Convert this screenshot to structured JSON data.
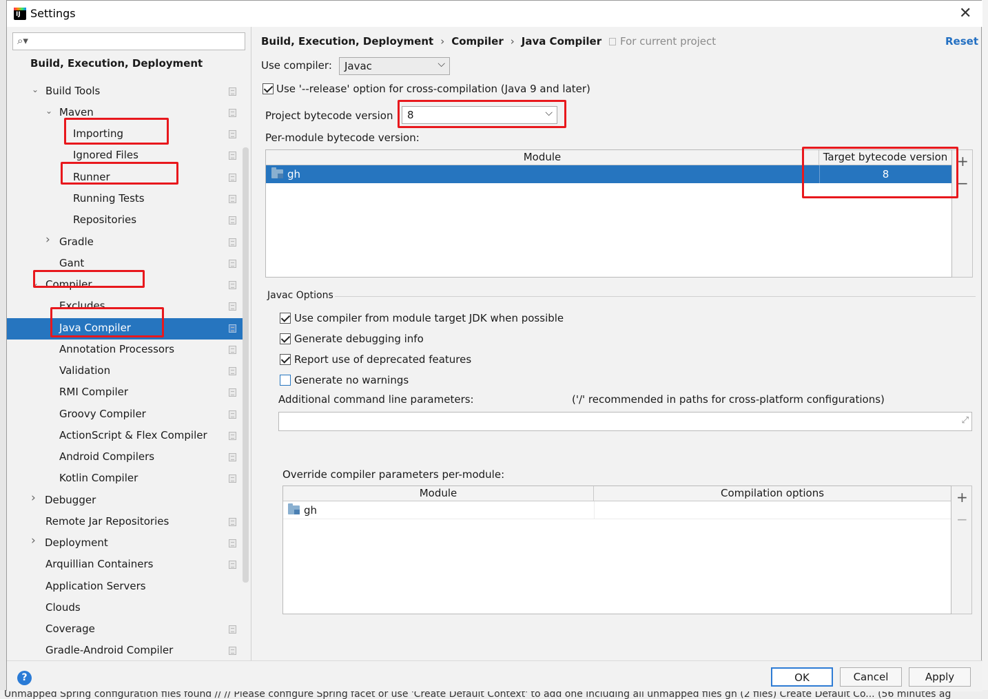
{
  "window": {
    "title": "Settings"
  },
  "background": {
    "status_text": "Unmapped Spring configuration files found  // // Please configure Spring facet or use 'Create Default Context' to add one including all unmapped files  gh (2 files)  Create Default Co...  (56 minutes ag"
  },
  "sidebar": {
    "search_placeholder": "",
    "section_title": "Build, Execution, Deployment",
    "items": [
      {
        "label": "Build Tools",
        "arrow": "expanded",
        "project_scoped": true
      },
      {
        "label": "Maven",
        "arrow": "expanded",
        "project_scoped": true
      },
      {
        "label": "Importing",
        "arrow": "",
        "project_scoped": true
      },
      {
        "label": "Ignored Files",
        "arrow": "",
        "project_scoped": true
      },
      {
        "label": "Runner",
        "arrow": "",
        "project_scoped": true
      },
      {
        "label": "Running Tests",
        "arrow": "",
        "project_scoped": true
      },
      {
        "label": "Repositories",
        "arrow": "",
        "project_scoped": true
      },
      {
        "label": "Gradle",
        "arrow": "collapsed",
        "project_scoped": true
      },
      {
        "label": "Gant",
        "arrow": "",
        "project_scoped": true
      },
      {
        "label": "Compiler",
        "arrow": "expanded",
        "project_scoped": true
      },
      {
        "label": "Excludes",
        "arrow": "",
        "project_scoped": true
      },
      {
        "label": "Java Compiler",
        "arrow": "",
        "project_scoped": true,
        "selected": true
      },
      {
        "label": "Annotation Processors",
        "arrow": "",
        "project_scoped": true
      },
      {
        "label": "Validation",
        "arrow": "",
        "project_scoped": true
      },
      {
        "label": "RMI Compiler",
        "arrow": "",
        "project_scoped": true
      },
      {
        "label": "Groovy Compiler",
        "arrow": "",
        "project_scoped": true
      },
      {
        "label": "ActionScript & Flex Compiler",
        "arrow": "",
        "project_scoped": true
      },
      {
        "label": "Android Compilers",
        "arrow": "",
        "project_scoped": true
      },
      {
        "label": "Kotlin Compiler",
        "arrow": "",
        "project_scoped": true
      },
      {
        "label": "Debugger",
        "arrow": "collapsed",
        "project_scoped": false
      },
      {
        "label": "Remote Jar Repositories",
        "arrow": "",
        "project_scoped": true
      },
      {
        "label": "Deployment",
        "arrow": "collapsed",
        "project_scoped": true
      },
      {
        "label": "Arquillian Containers",
        "arrow": "",
        "project_scoped": true
      },
      {
        "label": "Application Servers",
        "arrow": "",
        "project_scoped": false
      },
      {
        "label": "Clouds",
        "arrow": "",
        "project_scoped": false
      },
      {
        "label": "Coverage",
        "arrow": "",
        "project_scoped": true
      },
      {
        "label": "Gradle-Android Compiler",
        "arrow": "",
        "project_scoped": true
      }
    ]
  },
  "breadcrumb": {
    "parts": [
      "Build, Execution, Deployment",
      "Compiler",
      "Java Compiler"
    ],
    "separator": "›",
    "scope": "For current project",
    "reset": "Reset"
  },
  "compiler": {
    "use_compiler_label": "Use compiler:",
    "use_compiler_value": "Javac",
    "release_option_label": "Use '--release' option for cross-compilation (Java 9 and later)",
    "release_option_checked": true,
    "project_bytecode_label": "Project bytecode version",
    "project_bytecode_value": "8",
    "per_module_label": "Per-module bytecode version:",
    "module_table": {
      "columns": [
        "Module",
        "Target bytecode version"
      ],
      "rows": [
        {
          "module": "gh",
          "target": "8"
        }
      ]
    }
  },
  "javac": {
    "section_title": "Javac Options",
    "options": [
      {
        "label": "Use compiler from module target JDK when possible",
        "checked": true
      },
      {
        "label": "Generate debugging info",
        "checked": true
      },
      {
        "label": "Report use of deprecated features",
        "checked": true
      },
      {
        "label": "Generate no warnings",
        "checked": false
      }
    ],
    "additional_params_label": "Additional command line parameters:",
    "additional_params_hint": "('/' recommended in paths for cross-platform configurations)",
    "additional_params_value": "",
    "override_label": "Override compiler parameters per-module:",
    "override_table": {
      "columns": [
        "Module",
        "Compilation options"
      ],
      "rows": [
        {
          "module": "gh",
          "options": ""
        }
      ]
    }
  },
  "buttons": {
    "ok": "OK",
    "cancel": "Cancel",
    "apply": "Apply",
    "help": "?"
  },
  "icons": {
    "add": "+",
    "remove": "−",
    "expand": "⤢",
    "close": "✕",
    "search": "🔍︎"
  },
  "colors": {
    "selection": "#2675bf",
    "link": "#2470c2",
    "highlight_box": "#e8181d"
  }
}
